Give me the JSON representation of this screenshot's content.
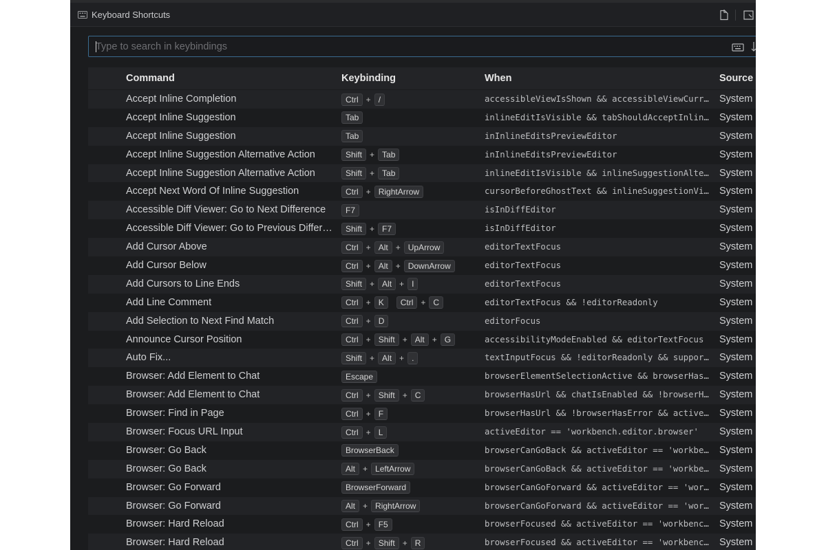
{
  "window": {
    "title": "Keyboard Shortcuts",
    "icons": {
      "tab": "keyboard-icon",
      "open_json": "open-keybindings-json-icon",
      "split": "split-editor-icon"
    }
  },
  "search": {
    "placeholder": "Type to search in keybindings",
    "value": "",
    "icons": [
      "keyboard-record-icon",
      "sort-by-precedence-icon"
    ]
  },
  "columns": {
    "command": "Command",
    "keybinding": "Keybinding",
    "when": "When",
    "source": "Source"
  },
  "colors": {
    "background": "#1b1c1e",
    "focus_border": "#3a6b8f",
    "row_alt": "#222326",
    "keycap": "#303134"
  },
  "rows": [
    {
      "command": "Accept Inline Completion",
      "keys": [
        [
          "Ctrl",
          "/"
        ]
      ],
      "when": "accessibleViewIsShown && accessibleViewCurre…",
      "source": "System"
    },
    {
      "command": "Accept Inline Suggestion",
      "keys": [
        [
          "Tab"
        ]
      ],
      "when": "inlineEditIsVisible && tabShouldAcceptInline…",
      "source": "System"
    },
    {
      "command": "Accept Inline Suggestion",
      "keys": [
        [
          "Tab"
        ]
      ],
      "when": "inInlineEditsPreviewEditor",
      "source": "System"
    },
    {
      "command": "Accept Inline Suggestion Alternative Action",
      "keys": [
        [
          "Shift",
          "Tab"
        ]
      ],
      "when": "inInlineEditsPreviewEditor",
      "source": "System"
    },
    {
      "command": "Accept Inline Suggestion Alternative Action",
      "keys": [
        [
          "Shift",
          "Tab"
        ]
      ],
      "when": "inlineEditIsVisible && inlineSuggestionAlter…",
      "source": "System"
    },
    {
      "command": "Accept Next Word Of Inline Suggestion",
      "keys": [
        [
          "Ctrl",
          "RightArrow"
        ]
      ],
      "when": "cursorBeforeGhostText && inlineSuggestionVis…",
      "source": "System"
    },
    {
      "command": "Accessible Diff Viewer: Go to Next Difference",
      "keys": [
        [
          "F7"
        ]
      ],
      "when": "isInDiffEditor",
      "source": "System"
    },
    {
      "command": "Accessible Diff Viewer: Go to Previous Differe…",
      "keys": [
        [
          "Shift",
          "F7"
        ]
      ],
      "when": "isInDiffEditor",
      "source": "System"
    },
    {
      "command": "Add Cursor Above",
      "keys": [
        [
          "Ctrl",
          "Alt",
          "UpArrow"
        ]
      ],
      "when": "editorTextFocus",
      "source": "System"
    },
    {
      "command": "Add Cursor Below",
      "keys": [
        [
          "Ctrl",
          "Alt",
          "DownArrow"
        ]
      ],
      "when": "editorTextFocus",
      "source": "System"
    },
    {
      "command": "Add Cursors to Line Ends",
      "keys": [
        [
          "Shift",
          "Alt",
          "I"
        ]
      ],
      "when": "editorTextFocus",
      "source": "System"
    },
    {
      "command": "Add Line Comment",
      "keys": [
        [
          "Ctrl",
          "K"
        ],
        [
          "Ctrl",
          "C"
        ]
      ],
      "when": "editorTextFocus && !editorReadonly",
      "source": "System"
    },
    {
      "command": "Add Selection to Next Find Match",
      "keys": [
        [
          "Ctrl",
          "D"
        ]
      ],
      "when": "editorFocus",
      "source": "System"
    },
    {
      "command": "Announce Cursor Position",
      "keys": [
        [
          "Ctrl",
          "Shift",
          "Alt",
          "G"
        ]
      ],
      "when": "accessibilityModeEnabled && editorTextFocus",
      "source": "System"
    },
    {
      "command": "Auto Fix...",
      "keys": [
        [
          "Shift",
          "Alt",
          "."
        ]
      ],
      "when": "textInputFocus && !editorReadonly && support…",
      "source": "System"
    },
    {
      "command": "Browser: Add Element to Chat",
      "keys": [
        [
          "Escape"
        ]
      ],
      "when": "browserElementSelectionActive && browserHasU…",
      "source": "System"
    },
    {
      "command": "Browser: Add Element to Chat",
      "keys": [
        [
          "Ctrl",
          "Shift",
          "C"
        ]
      ],
      "when": "browserHasUrl && chatIsEnabled && !browserHa…",
      "source": "System"
    },
    {
      "command": "Browser: Find in Page",
      "keys": [
        [
          "Ctrl",
          "F"
        ]
      ],
      "when": "browserHasUrl && !browserHasError && activeE…",
      "source": "System"
    },
    {
      "command": "Browser: Focus URL Input",
      "keys": [
        [
          "Ctrl",
          "L"
        ]
      ],
      "when": "activeEditor == 'workbench.editor.browser'",
      "source": "System"
    },
    {
      "command": "Browser: Go Back",
      "keys": [
        [
          "BrowserBack"
        ]
      ],
      "when": "browserCanGoBack && activeEditor == 'workben…",
      "source": "System"
    },
    {
      "command": "Browser: Go Back",
      "keys": [
        [
          "Alt",
          "LeftArrow"
        ]
      ],
      "when": "browserCanGoBack && activeEditor == 'workben…",
      "source": "System"
    },
    {
      "command": "Browser: Go Forward",
      "keys": [
        [
          "BrowserForward"
        ]
      ],
      "when": "browserCanGoForward && activeEditor == 'work…",
      "source": "System"
    },
    {
      "command": "Browser: Go Forward",
      "keys": [
        [
          "Alt",
          "RightArrow"
        ]
      ],
      "when": "browserCanGoForward && activeEditor == 'work…",
      "source": "System"
    },
    {
      "command": "Browser: Hard Reload",
      "keys": [
        [
          "Ctrl",
          "F5"
        ]
      ],
      "when": "browserFocused && activeEditor == 'workbench…",
      "source": "System"
    },
    {
      "command": "Browser: Hard Reload",
      "keys": [
        [
          "Ctrl",
          "Shift",
          "R"
        ]
      ],
      "when": "browserFocused && activeEditor == 'workbench…",
      "source": "System"
    }
  ]
}
